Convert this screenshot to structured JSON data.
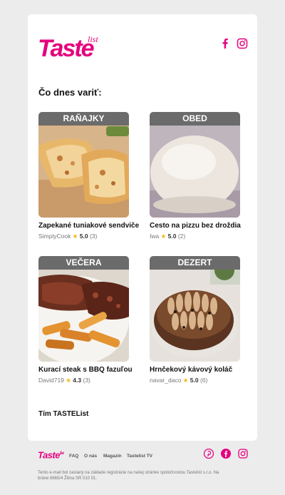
{
  "brand": {
    "logo_text": "Taste",
    "logo_sub": "list",
    "accent_color": "#e6007e"
  },
  "header": {
    "social": [
      {
        "name": "facebook-icon"
      },
      {
        "name": "instagram-icon"
      }
    ]
  },
  "main": {
    "heading": "Čo dnes variť:",
    "recipes": [
      {
        "category": "RAŇAJKY",
        "title": "Zapekané tuniakové sendviče",
        "author": "SimplyCook",
        "rating": "5.0",
        "count": "(3)"
      },
      {
        "category": "OBED",
        "title": "Cesto na pizzu bez droždia",
        "author": "Iwa",
        "rating": "5.0",
        "count": "(2)"
      },
      {
        "category": "VEČERA",
        "title": "Kurací steak s BBQ fazuľou",
        "author": "David719",
        "rating": "4.3",
        "count": "(3)"
      },
      {
        "category": "DEZERT",
        "title": "Hrnčekový kávový koláč",
        "author": "navar_daco",
        "rating": "5.0",
        "count": "(6)"
      }
    ],
    "star_glyph": "★",
    "signature": "Tím TASTEList"
  },
  "footer": {
    "logo_text": "Taste",
    "logo_sub": "list",
    "links": [
      "FAQ",
      "O nás",
      "Magazín",
      "Tastelist TV"
    ],
    "social": [
      "pinterest-icon",
      "facebook-icon",
      "instagram-icon"
    ],
    "disclaimer": "Tento e-mail bol zaslaný na základe registrácie na našej stránke spoločnostou Tastelist s.r.o. Na bráne 8665/4 Žilina SR 010 01."
  }
}
